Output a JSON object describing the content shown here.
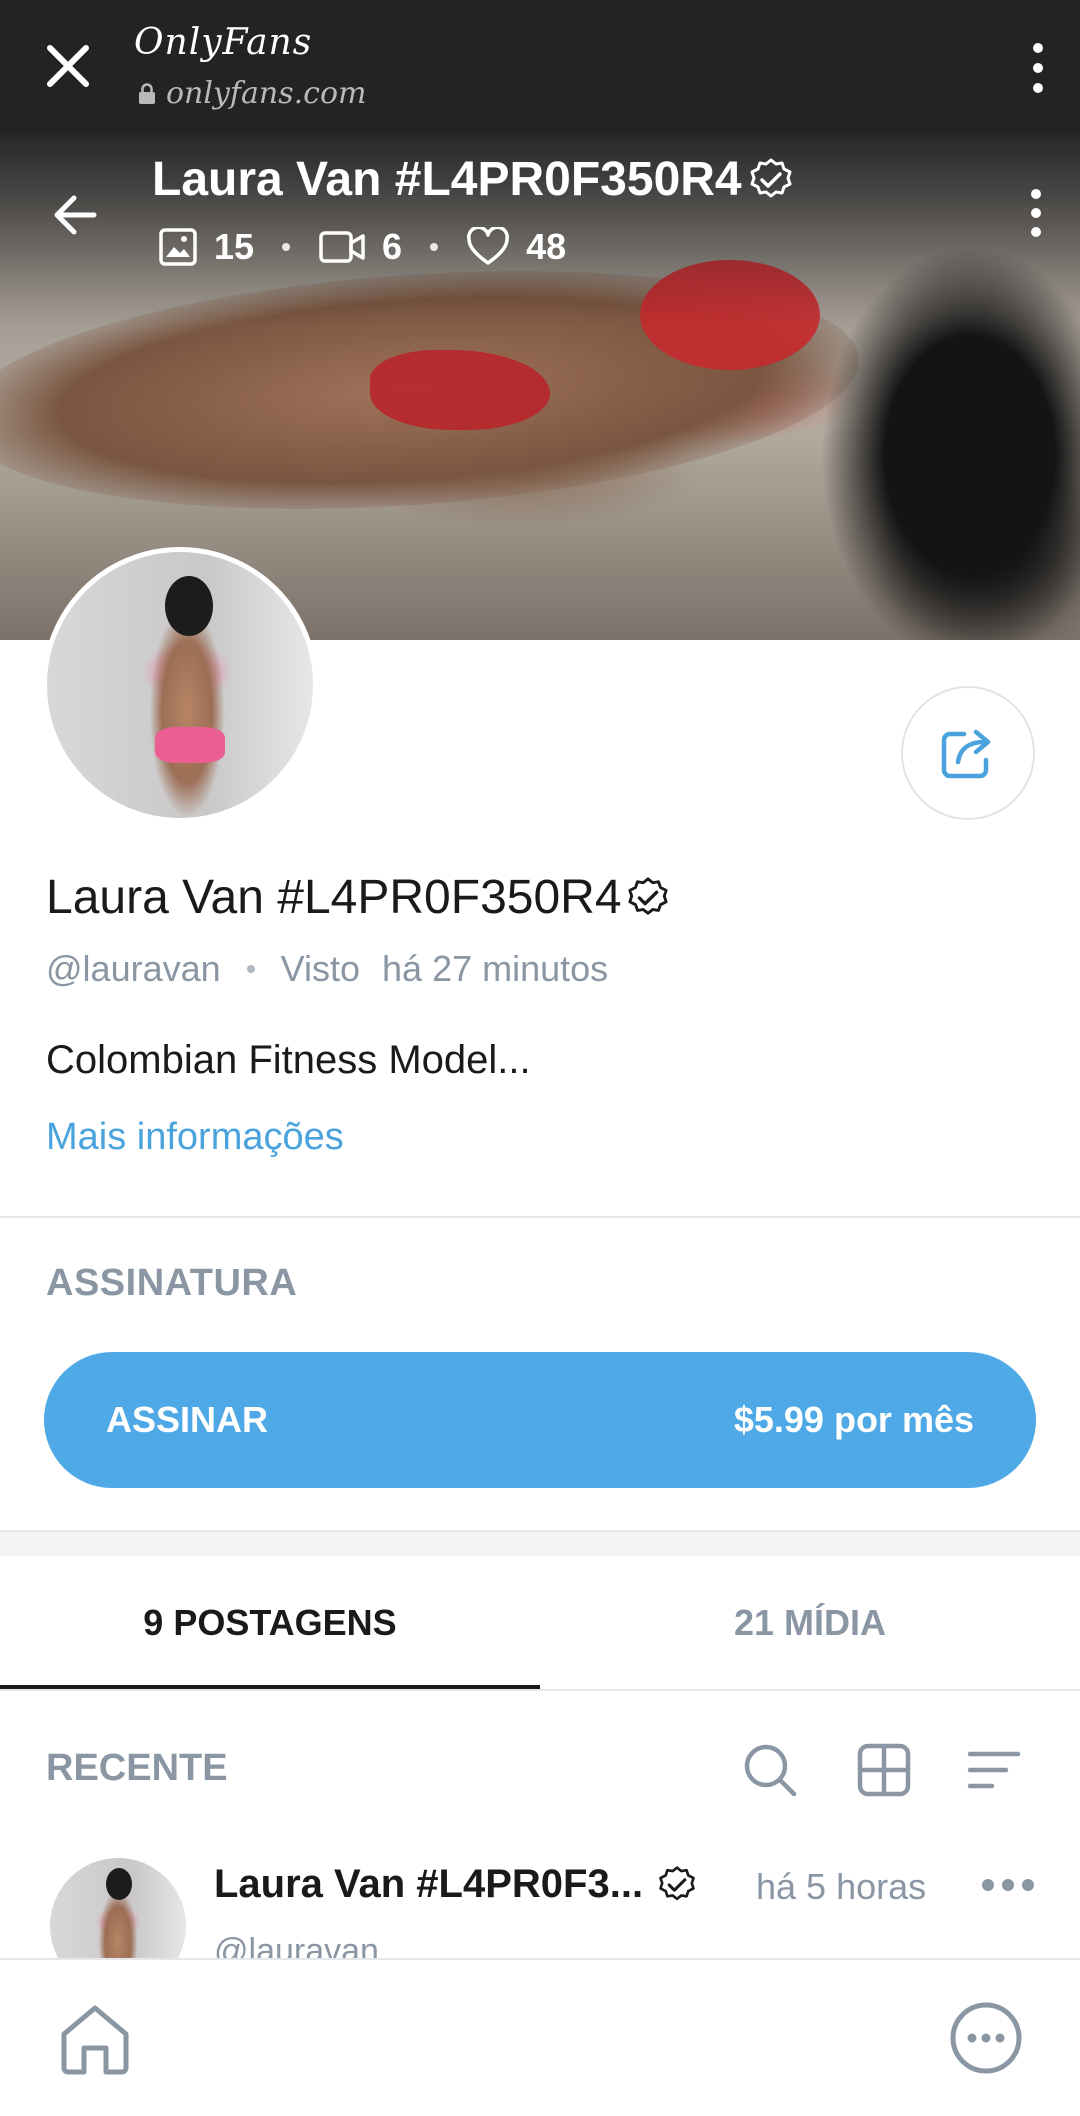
{
  "browser": {
    "title": "OnlyFans",
    "url": "onlyfans.com",
    "icons": [
      "close-icon",
      "lock-icon",
      "kebab-menu-icon"
    ]
  },
  "cover": {
    "name": "Laura Van #L4PR0F350R4",
    "stats": {
      "photos": "15",
      "videos": "6",
      "likes": "48"
    },
    "icons": [
      "arrow-left-icon",
      "image-icon",
      "video-icon",
      "heart-icon",
      "verified-icon",
      "kebab-menu-icon"
    ]
  },
  "profile": {
    "name": "Laura Van #L4PR0F350R4",
    "handle": "@lauravan",
    "seen_label": "Visto",
    "seen_time": "há 27 minutos",
    "bio": "Colombian Fitness Model...",
    "more_info": "Mais informações"
  },
  "subscription": {
    "section_title": "ASSINATURA",
    "button_label": "ASSINAR",
    "price": "$5.99 por mês",
    "accent": "#4fa9e6"
  },
  "tabs": [
    {
      "label": "9 POSTAGENS",
      "active": true
    },
    {
      "label": "21 MÍDIA",
      "active": false
    }
  ],
  "feed": {
    "section_title": "RECENTE",
    "icons": [
      "search-icon",
      "grid-icon",
      "sort-icon"
    ]
  },
  "post": {
    "name": "Laura Van #L4PR0F3...",
    "time": "há 5 horas",
    "handle": "@lauravan"
  },
  "bottom_nav": {
    "icons": [
      "home-icon",
      "more-circle-icon"
    ]
  }
}
